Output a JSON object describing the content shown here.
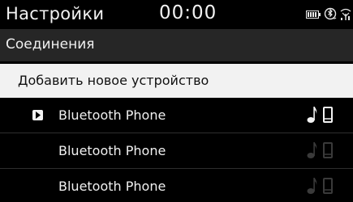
{
  "status_bar": {
    "title": "Настройки",
    "clock": "00:00",
    "icons": [
      "battery-icon",
      "bluetooth-phone-icon",
      "signal-icon"
    ]
  },
  "section": {
    "title": "Соединения"
  },
  "add_device": {
    "label": "Добавить новое устройство"
  },
  "devices": [
    {
      "name": "Bluetooth Phone",
      "connected": true,
      "icons": [
        "music-note-icon",
        "phone-icon"
      ]
    },
    {
      "name": "Bluetooth Phone",
      "connected": false,
      "icons": [
        "music-note-icon",
        "phone-icon"
      ]
    },
    {
      "name": "Bluetooth Phone",
      "connected": false,
      "icons": [
        "music-note-icon",
        "phone-icon"
      ]
    }
  ],
  "colors": {
    "background": "#000000",
    "header_bg": "#262626",
    "highlight_bg": "#f2f2f2",
    "active_icon": "#f2f2f2",
    "inactive_icon": "#3a3a3a"
  }
}
